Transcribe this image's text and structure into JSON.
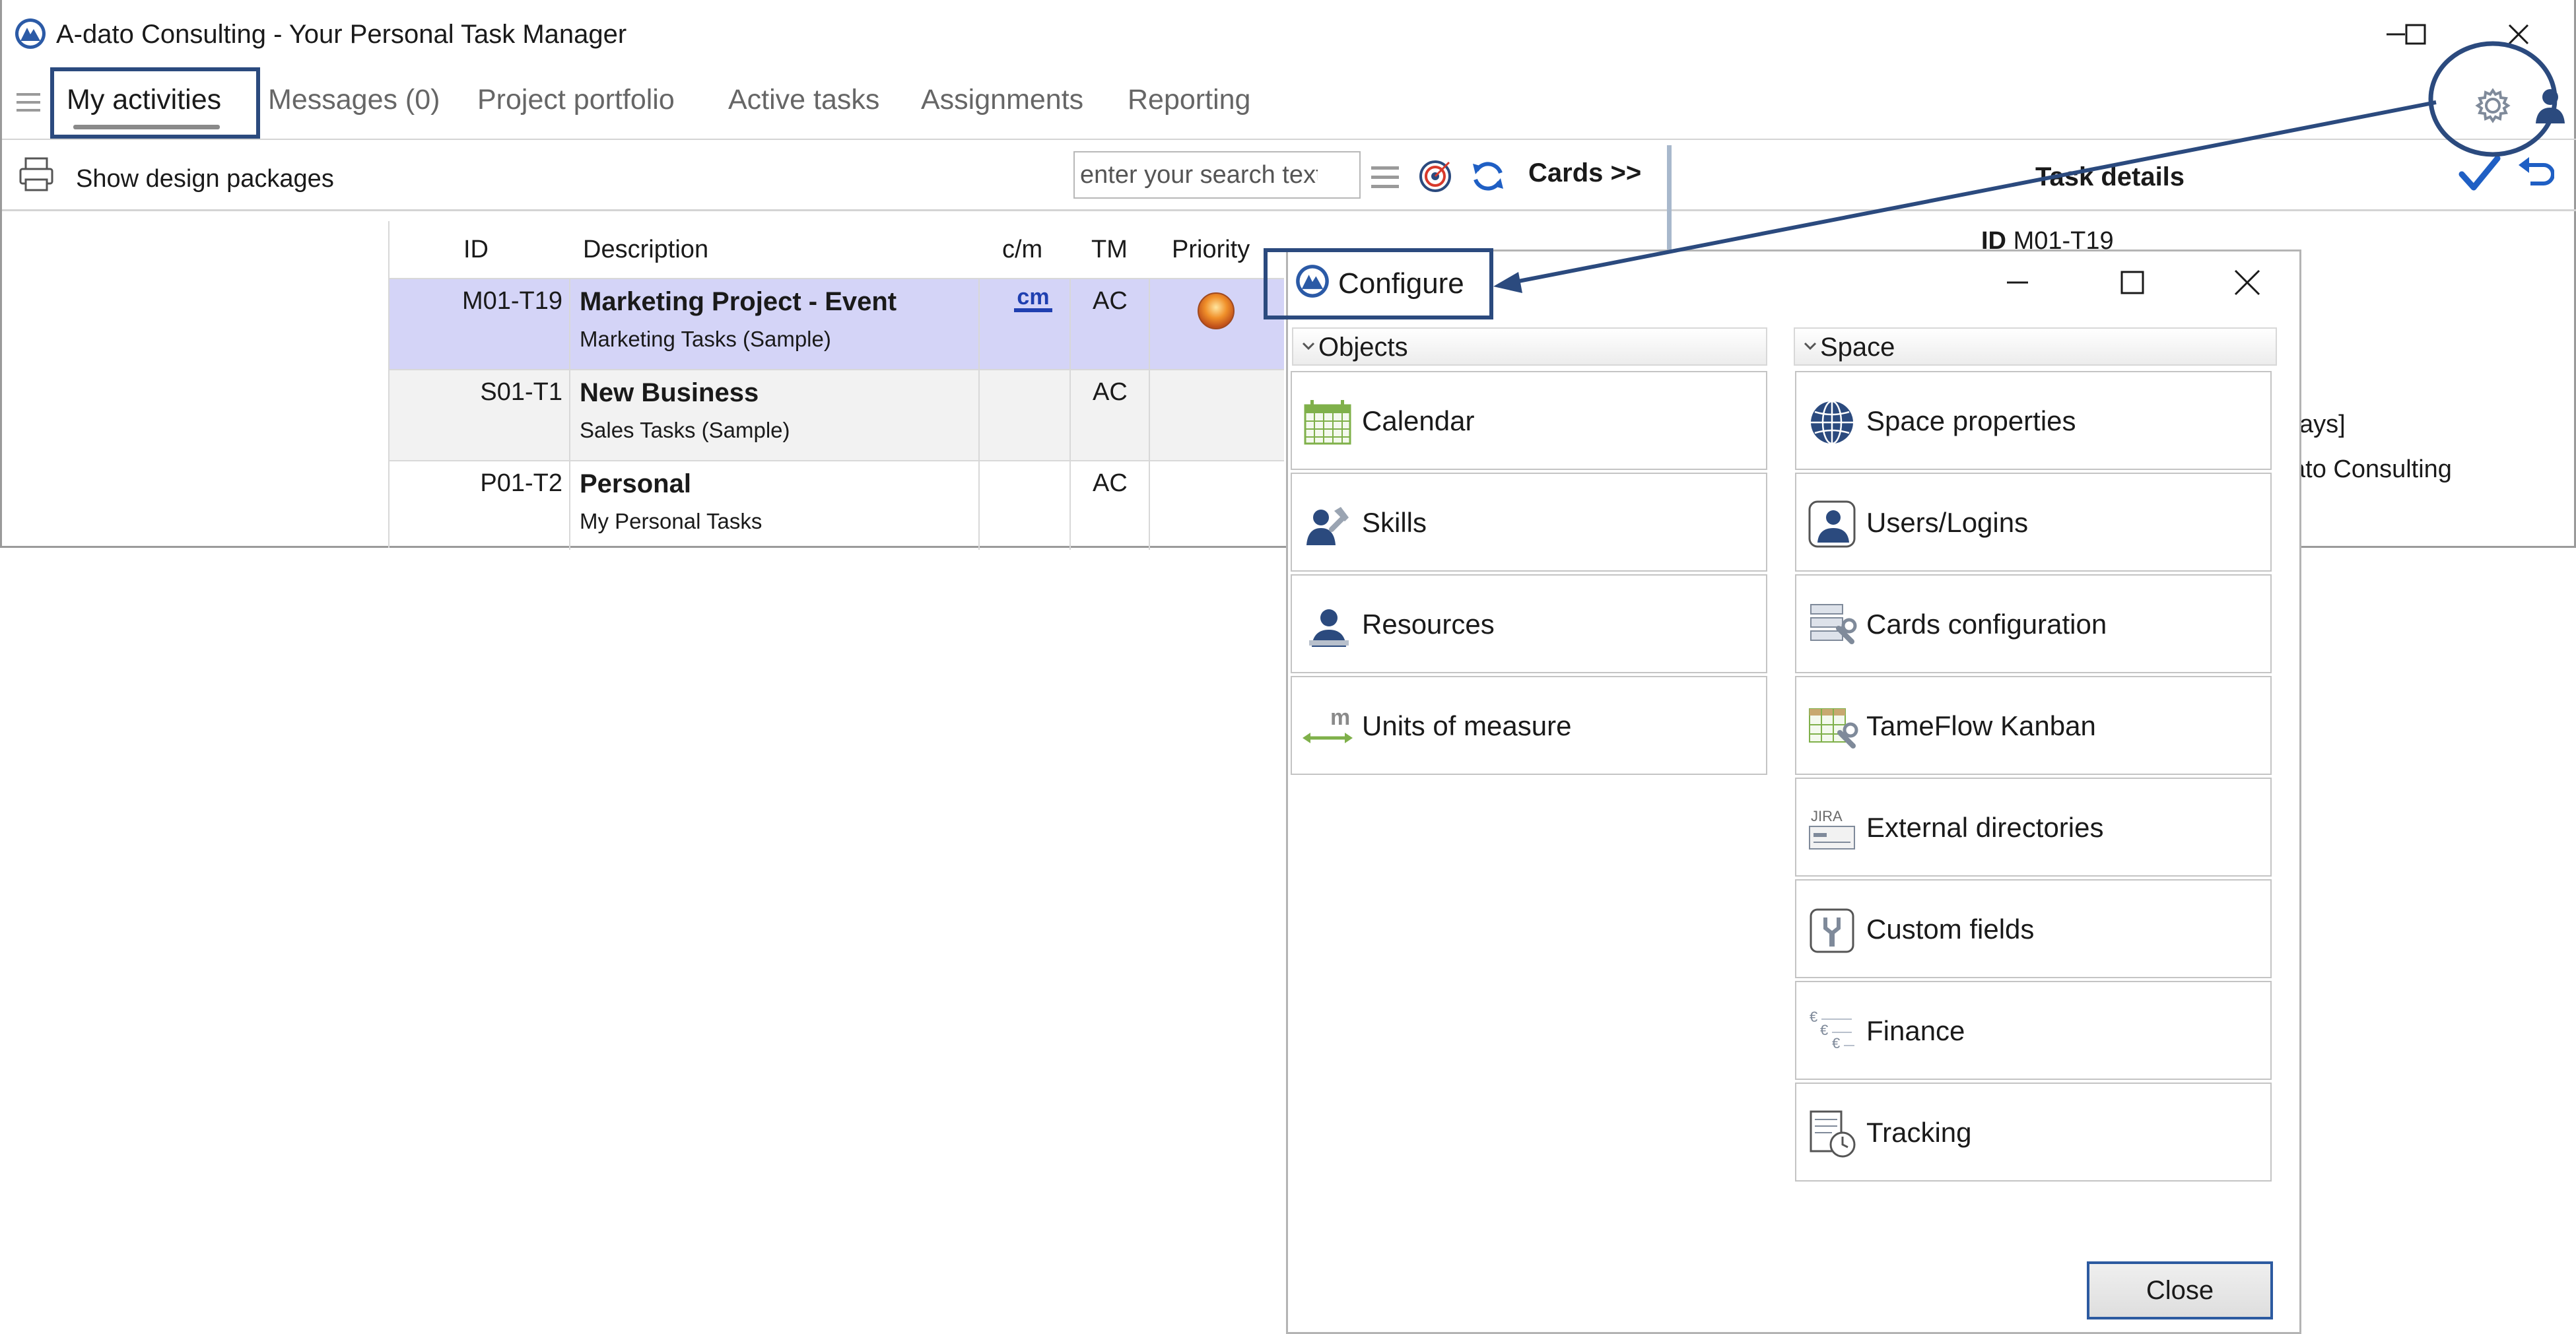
{
  "window": {
    "title": "A-dato Consulting - Your Personal Task Manager"
  },
  "tabs": [
    {
      "label": "My activities"
    },
    {
      "label": "Messages (0)"
    },
    {
      "label": "Project portfolio"
    },
    {
      "label": "Active tasks"
    },
    {
      "label": "Assignments"
    },
    {
      "label": "Reporting"
    }
  ],
  "toolbar": {
    "show_design_packages": "Show design packages",
    "search_placeholder": "enter your search text",
    "cards_label": "Cards >>"
  },
  "task_details": {
    "title": "Task details",
    "id_label": "ID",
    "id_value": "M01-T19",
    "partial_duration": "ays]",
    "partial_owner": "ato Consulting"
  },
  "grid": {
    "columns": [
      "ID",
      "Description",
      "c/m",
      "TM",
      "Priority"
    ],
    "rows": [
      {
        "id": "M01-T19",
        "title": "Marketing Project  - Event",
        "subtitle": "Marketing Tasks (Sample)",
        "cm": "cm",
        "tm": "AC"
      },
      {
        "id": "S01-T1",
        "title": "New Business",
        "subtitle": "Sales Tasks (Sample)",
        "tm": "AC"
      },
      {
        "id": "P01-T2",
        "title": "Personal",
        "subtitle": "My Personal Tasks",
        "tm": "AC"
      }
    ]
  },
  "dialog": {
    "title": "Configure",
    "sections": {
      "objects": {
        "label": "Objects",
        "items": [
          {
            "label": "Calendar",
            "icon": "calendar-icon"
          },
          {
            "label": "Skills",
            "icon": "skills-icon"
          },
          {
            "label": "Resources",
            "icon": "resources-icon"
          },
          {
            "label": "Units of measure",
            "icon": "units-icon"
          }
        ]
      },
      "space": {
        "label": "Space",
        "items": [
          {
            "label": "Space properties",
            "icon": "globe-icon"
          },
          {
            "label": "Users/Logins",
            "icon": "users-icon"
          },
          {
            "label": "Cards configuration",
            "icon": "cards-config-icon"
          },
          {
            "label": "TameFlow Kanban",
            "icon": "kanban-icon"
          },
          {
            "label": "External directories",
            "icon": "jira-icon"
          },
          {
            "label": "Custom fields",
            "icon": "custom-fields-icon"
          },
          {
            "label": "Finance",
            "icon": "finance-icon"
          },
          {
            "label": "Tracking",
            "icon": "tracking-icon"
          }
        ]
      }
    },
    "jira_text": "JIRA",
    "units_text": "m",
    "close_label": "Close"
  },
  "colors": {
    "accent": "#2b4a7e",
    "selected_row": "#d4d4f7",
    "link_blue": "#1f5fc4"
  }
}
